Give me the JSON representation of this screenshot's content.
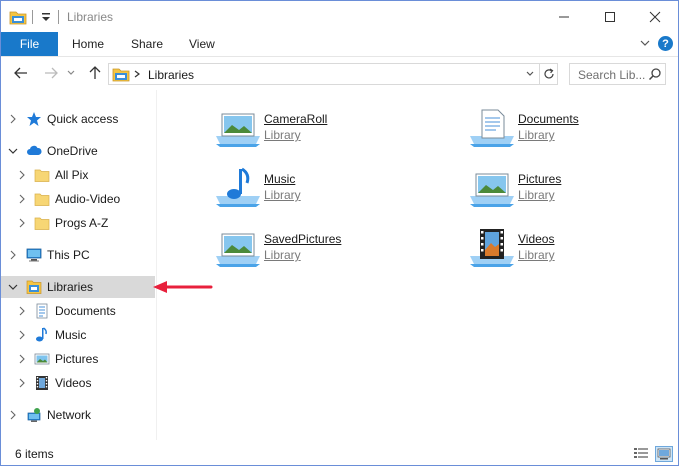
{
  "window": {
    "title": "Libraries"
  },
  "ribbon": {
    "file": "File",
    "tabs": [
      "Home",
      "Share",
      "View"
    ],
    "help": "?"
  },
  "address": {
    "path": "Libraries"
  },
  "search": {
    "placeholder": "Search Lib..."
  },
  "nav": {
    "items": [
      {
        "label": "Quick access",
        "icon": "star-icon"
      },
      {
        "label": "OneDrive",
        "icon": "cloud-icon"
      },
      {
        "label": "All Pix",
        "icon": "folder-icon"
      },
      {
        "label": "Audio-Video",
        "icon": "folder-icon"
      },
      {
        "label": "Progs A-Z",
        "icon": "folder-icon"
      },
      {
        "label": "This PC",
        "icon": "computer-icon"
      },
      {
        "label": "Libraries",
        "icon": "libraries-icon"
      },
      {
        "label": "Documents",
        "icon": "documents-icon"
      },
      {
        "label": "Music",
        "icon": "music-icon"
      },
      {
        "label": "Pictures",
        "icon": "pictures-icon"
      },
      {
        "label": "Videos",
        "icon": "videos-icon"
      },
      {
        "label": "Network",
        "icon": "network-icon"
      }
    ],
    "selected": "Libraries"
  },
  "libraries": [
    {
      "name": "CameraRoll",
      "type": "Library",
      "icon": "picture-library-icon"
    },
    {
      "name": "Documents",
      "type": "Library",
      "icon": "documents-library-icon"
    },
    {
      "name": "Music",
      "type": "Library",
      "icon": "music-library-icon"
    },
    {
      "name": "Pictures",
      "type": "Library",
      "icon": "picture-library-icon"
    },
    {
      "name": "SavedPictures",
      "type": "Library",
      "icon": "picture-library-icon"
    },
    {
      "name": "Videos",
      "type": "Library",
      "icon": "videos-library-icon"
    }
  ],
  "status": {
    "count": "6 items"
  },
  "colors": {
    "accent": "#1979ca",
    "selection": "#d9d9d9",
    "arrow": "#e8203c",
    "folder": "#f7d674"
  }
}
